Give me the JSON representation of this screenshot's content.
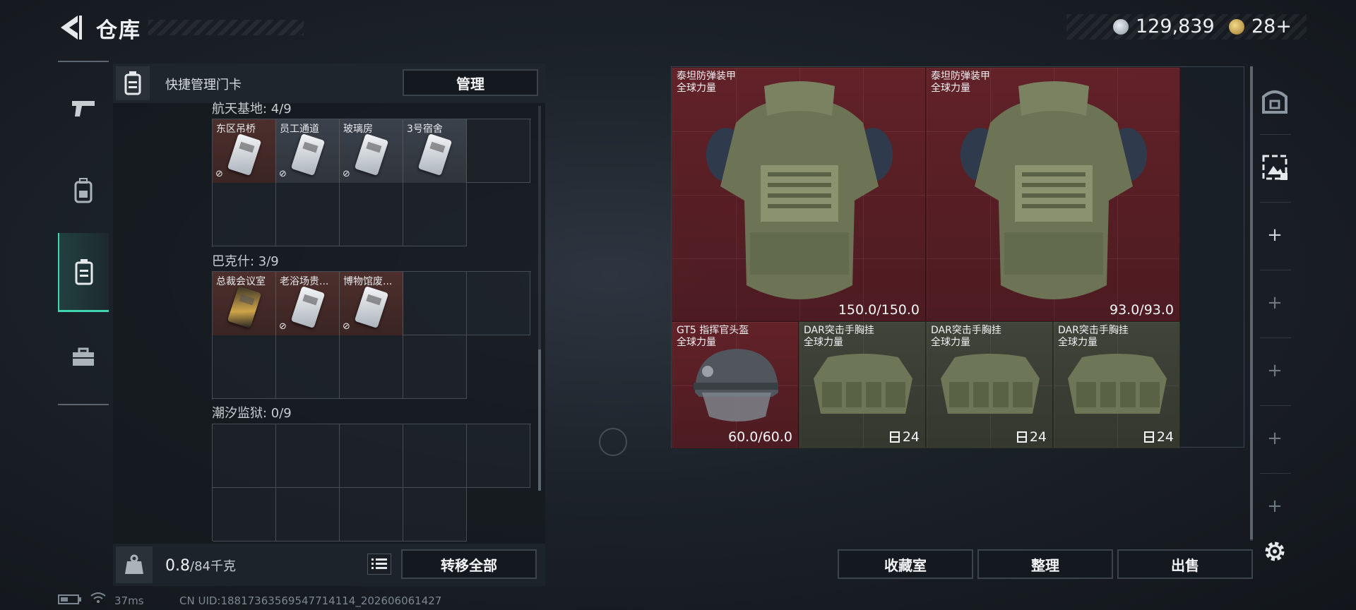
{
  "header": {
    "title": "仓库",
    "currency_silver": "129,839",
    "currency_gold": "28+"
  },
  "left_panel": {
    "header_label": "快捷管理门卡",
    "manage_button": "管理",
    "sections": [
      {
        "label": "航天基地: 4/9",
        "cards": [
          {
            "name": "东区吊桥",
            "color": "red",
            "locked": true
          },
          {
            "name": "员工通道",
            "color": "gray",
            "locked": true
          },
          {
            "name": "玻璃房",
            "color": "gray",
            "locked": true
          },
          {
            "name": "3号宿舍",
            "color": "gray",
            "locked": false
          }
        ]
      },
      {
        "label": "巴克什: 3/9",
        "cards": [
          {
            "name": "总裁会议室",
            "color": "red",
            "locked": false,
            "gold": true
          },
          {
            "name": "老浴场贵...",
            "color": "red",
            "locked": true
          },
          {
            "name": "博物馆废...",
            "color": "red",
            "locked": true
          }
        ]
      },
      {
        "label": "潮汐监狱: 0/9",
        "cards": []
      }
    ],
    "weight_value": "0.8",
    "weight_max": "/84千克",
    "transfer_button": "转移全部"
  },
  "right_panel": {
    "items": [
      {
        "line1": "泰坦防弹装甲",
        "line2": "全球力量",
        "value": "150.0/150.0",
        "kind": "armor",
        "tint": "red"
      },
      {
        "line1": "泰坦防弹装甲",
        "line2": "全球力量",
        "value": "93.0/93.0",
        "kind": "armor",
        "tint": "red"
      },
      {
        "line1": "GT5 指挥官头盔",
        "line2": "全球力量",
        "value": "60.0/60.0",
        "kind": "helmet",
        "tint": "red"
      },
      {
        "line1": "DAR突击手胸挂",
        "line2": "全球力量",
        "value": "24",
        "kind": "rig",
        "tint": "gray"
      },
      {
        "line1": "DAR突击手胸挂",
        "line2": "全球力量",
        "value": "24",
        "kind": "rig",
        "tint": "gray"
      },
      {
        "line1": "DAR突击手胸挂",
        "line2": "全球力量",
        "value": "24",
        "kind": "rig",
        "tint": "gray"
      }
    ],
    "buttons": {
      "collection": "收藏室",
      "organize": "整理",
      "sell": "出售"
    }
  },
  "status": {
    "ping": "37ms",
    "uid": "CN UID:18817363569547714114_202606061427"
  },
  "icons": {
    "back": "back-arrow-icon",
    "rail": [
      "pistol-icon",
      "backpack-icon",
      "keycard-holder-icon",
      "toolbox-icon"
    ],
    "right_rail": [
      "safe-box-icon",
      "capture-icon",
      "plus-icon",
      "settings-gear-icon"
    ]
  }
}
